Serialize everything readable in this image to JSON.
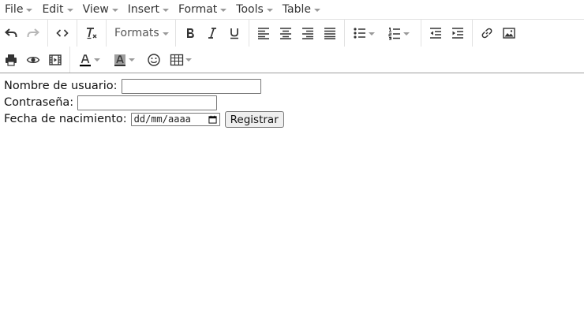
{
  "menubar": {
    "items": [
      {
        "label": "File"
      },
      {
        "label": "Edit"
      },
      {
        "label": "View"
      },
      {
        "label": "Insert"
      },
      {
        "label": "Format"
      },
      {
        "label": "Tools"
      },
      {
        "label": "Table"
      }
    ]
  },
  "toolbar": {
    "formats_label": "Formats",
    "row1_icons": [
      "undo-icon",
      "redo-icon",
      "source-code-icon",
      "clear-formatting-icon",
      "bold-icon",
      "italic-icon",
      "underline-icon",
      "align-left-icon",
      "align-center-icon",
      "align-right-icon",
      "align-justify-icon",
      "bullet-list-icon",
      "numbered-list-icon",
      "outdent-icon",
      "indent-icon",
      "link-icon",
      "image-icon"
    ],
    "row2_icons": [
      "print-icon",
      "preview-icon",
      "media-icon",
      "text-color-icon",
      "background-color-icon",
      "emoticons-icon",
      "table-icon"
    ],
    "colors": {
      "text_color": "#000000",
      "background_color": "#9e9e9e"
    }
  },
  "form": {
    "username_label": "Nombre de usuario:",
    "username_value": "",
    "password_label": "Contraseña:",
    "password_value": "",
    "birthdate_label": "Fecha de nacimiento:",
    "birthdate_placeholder": "dd/mm/aaaa",
    "submit_label": "Registrar"
  }
}
